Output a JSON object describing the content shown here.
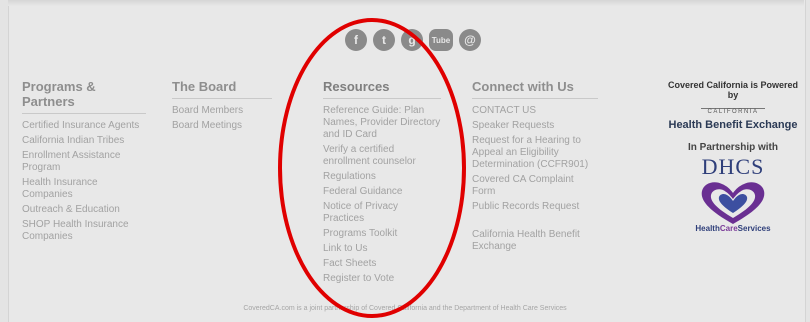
{
  "social": [
    "f",
    "t",
    "g",
    "Tube",
    "@"
  ],
  "columns": {
    "programs": {
      "heading": "Programs & Partners",
      "items": [
        "Certified Insurance Agents",
        "California Indian Tribes",
        "Enrollment Assistance Program",
        "Health Insurance Companies",
        "Outreach & Education",
        "SHOP Health Insurance Companies"
      ]
    },
    "board": {
      "heading": "The Board",
      "items": [
        "Board Members",
        "Board Meetings"
      ]
    },
    "resources": {
      "heading": "Resources",
      "items": [
        "Reference Guide: Plan Names, Provider Directory and ID Card",
        "Verify a certified enrollment counselor",
        "Regulations",
        "Federal Guidance",
        "Notice of Privacy Practices",
        "Programs Toolkit",
        "Link to Us",
        "Fact Sheets",
        "Register to Vote"
      ]
    },
    "connect": {
      "heading": "Connect with Us",
      "items": [
        "CONTACT US",
        "Speaker Requests",
        "Request for a Hearing to Appeal an Eligibility Determination (CCFR901)",
        "Covered CA Complaint Form",
        "Public Records Request",
        "California Health Benefit Exchange"
      ]
    }
  },
  "powered": {
    "line1": "Covered California is Powered by",
    "california": "CALIFORNIA",
    "exchange": "Health Benefit Exchange",
    "partnership": "In Partnership with",
    "dhcs": "DHCS",
    "hcs_health": "Health",
    "hcs_care": "Care",
    "hcs_services": "Services"
  },
  "disclaimer": "CoveredCA.com is a joint partnership of Covered California and the Department of Health Care Services",
  "colors": {
    "annotation": "#e00000",
    "footer_bg": "#e8e8e8",
    "link": "#a2a2a2"
  }
}
